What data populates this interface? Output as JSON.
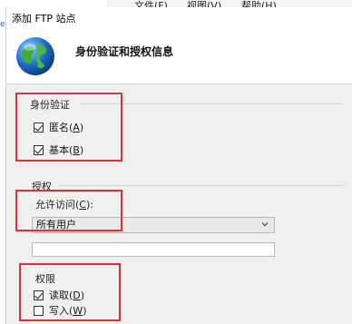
{
  "background_window": {
    "menu": [
      "文件(F)",
      "视图(V)",
      "帮助(H)"
    ],
    "edge_text": "er"
  },
  "dialog": {
    "title": "添加 FTP 站点",
    "header": "身份验证和授权信息"
  },
  "auth": {
    "group_label": "身份验证",
    "anonymous": {
      "text": "匿名(",
      "key": "A",
      "tail": ")",
      "checked": true
    },
    "basic": {
      "text": "基本(",
      "key": "B",
      "tail": ")",
      "checked": true
    }
  },
  "authorization": {
    "group_label": "授权",
    "allow_access_label_text": "允许访问(",
    "allow_access_key": "C",
    "allow_access_tail": "):",
    "allow_access_value": "所有用户",
    "user_field_value": ""
  },
  "permissions": {
    "group_label": "权限",
    "read": {
      "text": "读取(",
      "key": "D",
      "tail": ")",
      "checked": true
    },
    "write": {
      "text": "写入(",
      "key": "W",
      "tail": ")",
      "checked": false
    }
  },
  "colors": {
    "highlight_box": "#d9343a",
    "dialog_bg": "#f0f0f0",
    "header_bg": "#ffffff"
  }
}
